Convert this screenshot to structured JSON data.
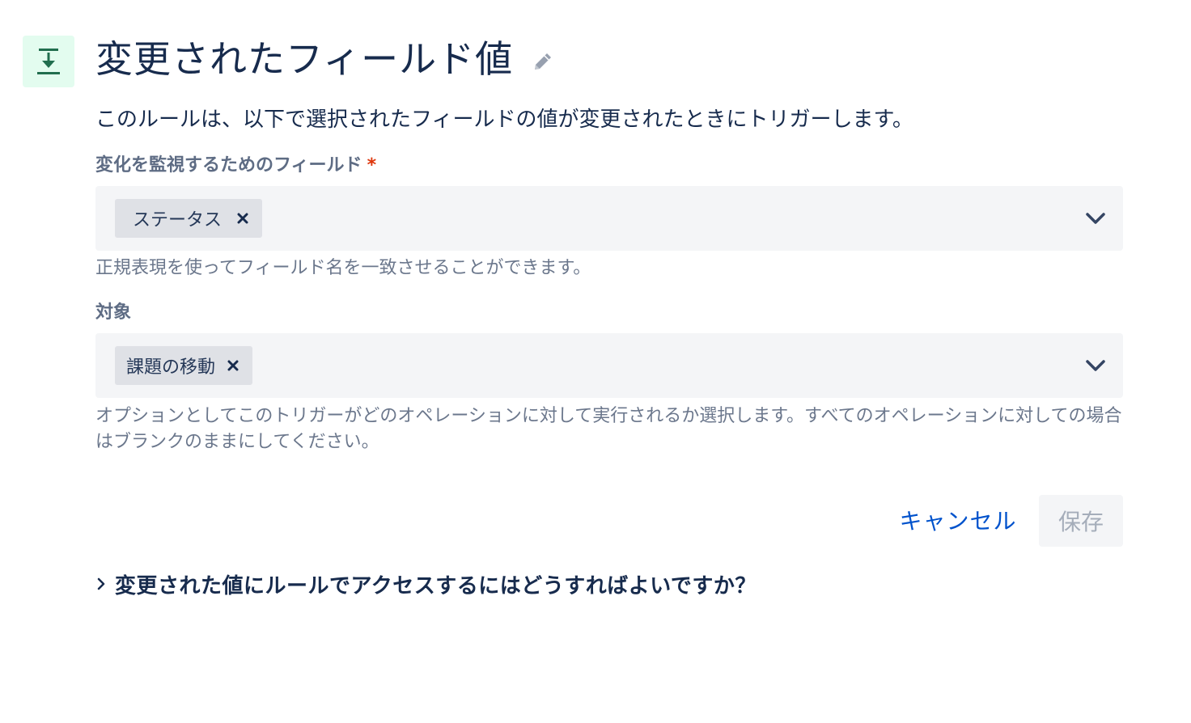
{
  "header": {
    "title": "変更されたフィールド値",
    "trigger_icon": "download-arrow-icon",
    "edit_icon": "pencil-icon",
    "icon_color": "#216e4e",
    "icon_bg": "#e3fcef"
  },
  "description": "このルールは、以下で選択されたフィールドの値が変更されたときにトリガーします。",
  "fields_to_monitor": {
    "label": "変化を監視するためのフィールド",
    "required_mark": "*",
    "selected": [
      "ステータス"
    ],
    "remove_icon": "close-icon",
    "dropdown_icon": "chevron-down-icon",
    "helper": "正規表現を使ってフィールド名を一致させることができます。"
  },
  "target": {
    "label": "対象",
    "selected": [
      "課題の移動"
    ],
    "remove_icon": "close-icon",
    "dropdown_icon": "chevron-down-icon",
    "helper": "オプションとしてこのトリガーがどのオペレーションに対して実行されるか選択します。すべてのオペレーションに対しての場合はブランクのままにしてください。"
  },
  "actions": {
    "cancel_label": "キャンセル",
    "save_label": "保存",
    "cancel_color": "#0052cc",
    "save_disabled": true
  },
  "faq": {
    "icon": "chevron-right-icon",
    "question": "変更された値にルールでアクセスするにはどうすればよいですか？"
  }
}
